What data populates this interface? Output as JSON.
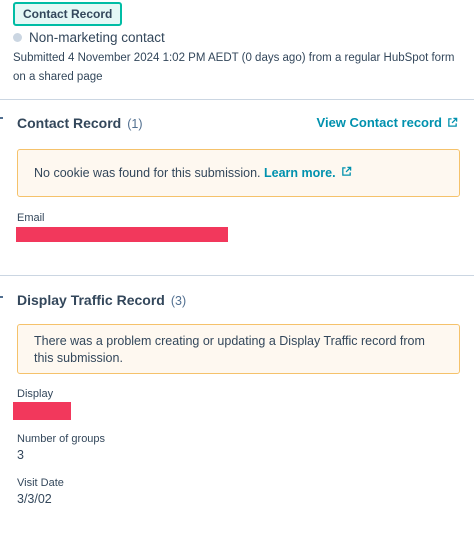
{
  "header": {
    "tag_label": "Contact Record",
    "contact_type": "Non-marketing contact",
    "submitted_text": "Submitted 4 November 2024 1:02 PM AEDT (0 days ago) from a regular HubSpot form on a shared page"
  },
  "contact_section": {
    "title": "Contact Record",
    "count": "(1)",
    "view_link": "View Contact record",
    "alert_text": "No cookie was found for this submission.",
    "alert_link": "Learn more.",
    "fields": [
      {
        "label": "Email",
        "value_redacted": true
      }
    ]
  },
  "traffic_section": {
    "title": "Display Traffic Record",
    "count": "(3)",
    "alert_text": "There was a problem creating or updating a Display Traffic record from this submission.",
    "fields": [
      {
        "label": "Display",
        "value_redacted": true
      },
      {
        "label": "Number of groups",
        "value": "3"
      },
      {
        "label": "Visit Date",
        "value": "3/3/02"
      }
    ]
  },
  "colors": {
    "accent_teal": "#00bda5",
    "link": "#0091ae",
    "alert_border": "#f5c26b",
    "redaction": "#f2385c"
  },
  "icons": [
    "external-link-icon",
    "status-dot-icon"
  ]
}
